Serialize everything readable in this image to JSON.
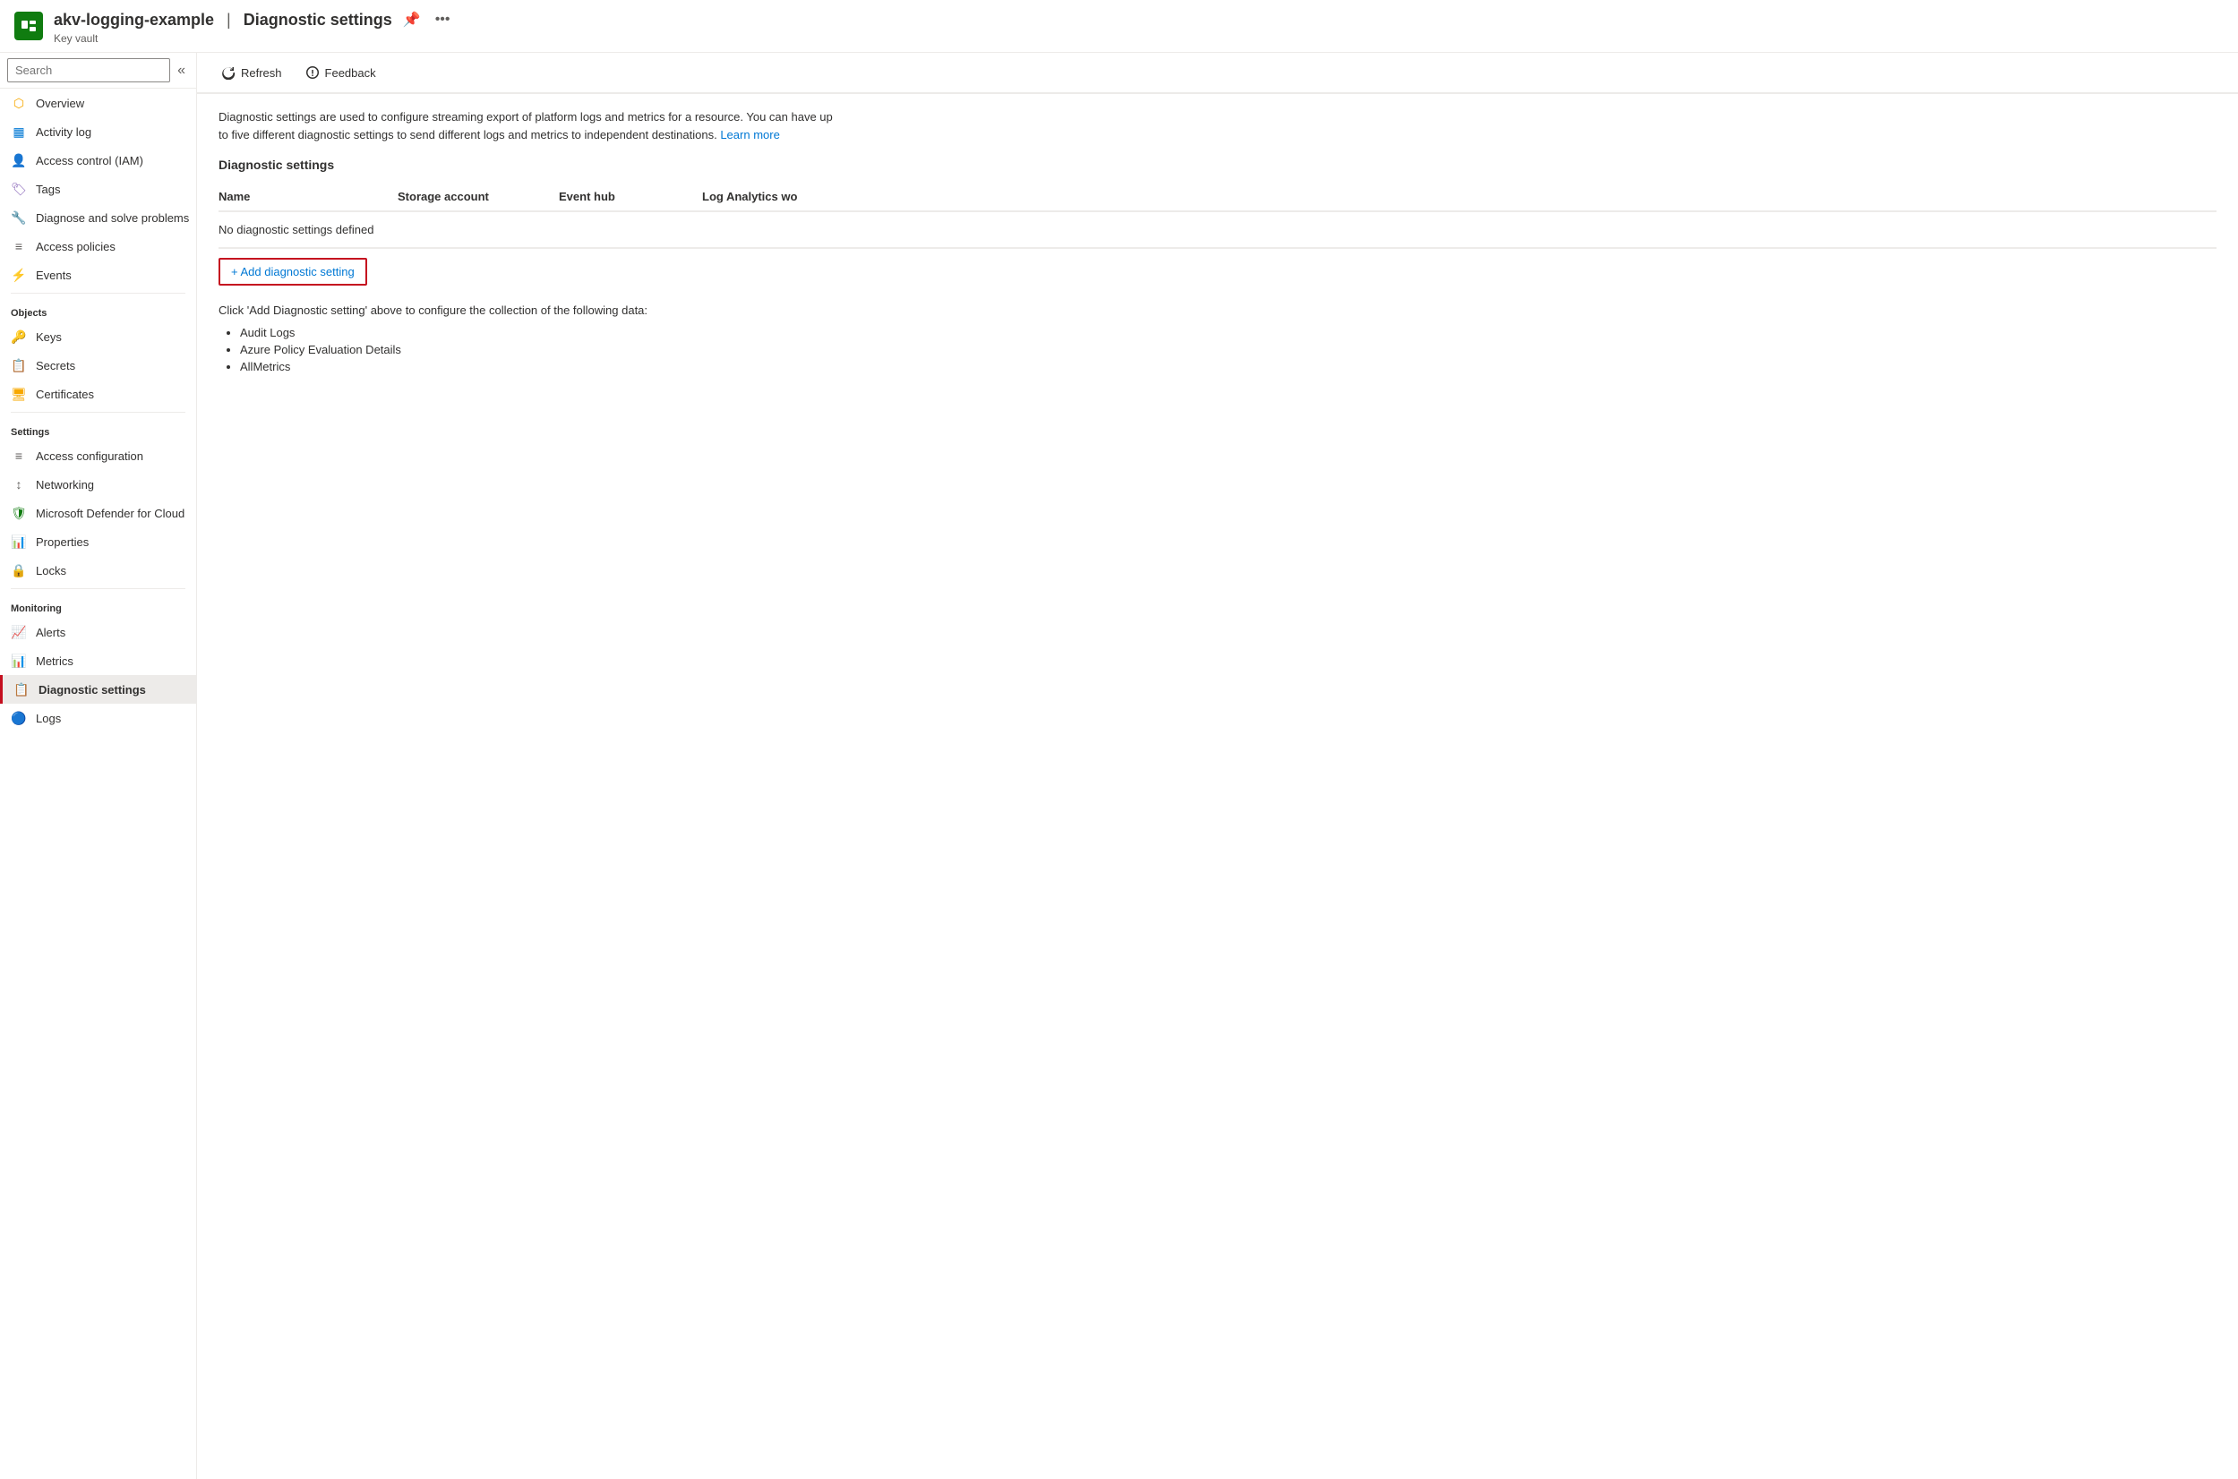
{
  "header": {
    "icon_color": "#107c10",
    "resource_name": "akv-logging-example",
    "separator": "|",
    "page_title": "Diagnostic settings",
    "subtitle": "Key vault",
    "pin_label": "Pin",
    "more_label": "More"
  },
  "sidebar": {
    "search_placeholder": "Search",
    "collapse_label": "Collapse",
    "items": [
      {
        "id": "overview",
        "label": "Overview",
        "icon": "overview"
      },
      {
        "id": "activity-log",
        "label": "Activity log",
        "icon": "activity"
      },
      {
        "id": "access-control",
        "label": "Access control (IAM)",
        "icon": "access-control"
      },
      {
        "id": "tags",
        "label": "Tags",
        "icon": "tags"
      },
      {
        "id": "diagnose",
        "label": "Diagnose and solve problems",
        "icon": "diagnose"
      },
      {
        "id": "access-policies",
        "label": "Access policies",
        "icon": "access-policies"
      },
      {
        "id": "events",
        "label": "Events",
        "icon": "events"
      }
    ],
    "sections": [
      {
        "label": "Objects",
        "items": [
          {
            "id": "keys",
            "label": "Keys",
            "icon": "keys"
          },
          {
            "id": "secrets",
            "label": "Secrets",
            "icon": "secrets"
          },
          {
            "id": "certificates",
            "label": "Certificates",
            "icon": "certificates"
          }
        ]
      },
      {
        "label": "Settings",
        "items": [
          {
            "id": "access-config",
            "label": "Access configuration",
            "icon": "access-config"
          },
          {
            "id": "networking",
            "label": "Networking",
            "icon": "networking"
          },
          {
            "id": "defender",
            "label": "Microsoft Defender for Cloud",
            "icon": "defender"
          },
          {
            "id": "properties",
            "label": "Properties",
            "icon": "properties"
          },
          {
            "id": "locks",
            "label": "Locks",
            "icon": "locks"
          }
        ]
      },
      {
        "label": "Monitoring",
        "items": [
          {
            "id": "alerts",
            "label": "Alerts",
            "icon": "alerts"
          },
          {
            "id": "metrics",
            "label": "Metrics",
            "icon": "metrics"
          },
          {
            "id": "diagnostic-settings",
            "label": "Diagnostic settings",
            "icon": "diagnostic",
            "active": true
          },
          {
            "id": "logs",
            "label": "Logs",
            "icon": "logs"
          }
        ]
      }
    ]
  },
  "toolbar": {
    "refresh_label": "Refresh",
    "feedback_label": "Feedback"
  },
  "content": {
    "description_part1": "Diagnostic settings are used to configure streaming export of platform logs and metrics for a resource. You can have up to five different diagnostic settings to send different logs and metrics to independent destinations.",
    "learn_more_label": "Learn more",
    "section_title": "Diagnostic settings",
    "table_columns": [
      "Name",
      "Storage account",
      "Event hub",
      "Log Analytics wo"
    ],
    "empty_message": "No diagnostic settings defined",
    "add_button_label": "+ Add diagnostic setting",
    "collection_prompt": "Click 'Add Diagnostic setting' above to configure the collection of the following data:",
    "collection_items": [
      "Audit Logs",
      "Azure Policy Evaluation Details",
      "AllMetrics"
    ]
  }
}
